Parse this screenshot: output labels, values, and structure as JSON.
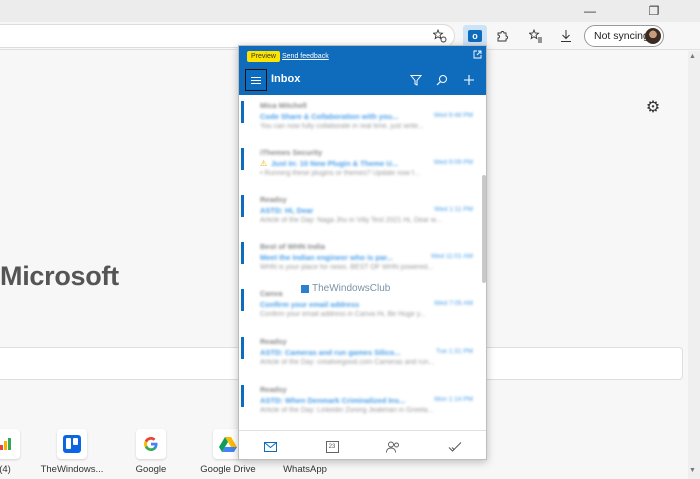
{
  "browser": {
    "sync_label": "Not syncing",
    "toolbar_icons": [
      "reading-view-icon",
      "outlook-extension-icon",
      "extensions-icon",
      "favorites-icon",
      "downloads-icon"
    ]
  },
  "page": {
    "title": "Microsoft",
    "tiles": [
      {
        "label": "(4)",
        "icon": "app-icon"
      },
      {
        "label": "TheWindows...",
        "icon": "trello-icon"
      },
      {
        "label": "Google",
        "icon": "google-icon"
      },
      {
        "label": "Google Drive",
        "icon": "google-drive-icon"
      },
      {
        "label": "WhatsApp",
        "icon": "whatsapp-icon"
      }
    ]
  },
  "outlook": {
    "preview_badge": "Preview",
    "feedback_link": "Send feedback",
    "folder": "Inbox",
    "messages": [
      {
        "sender": "Mica Mitchell",
        "subject": "Code Share & Collaboration with you...",
        "date": "Wed 9:48 PM",
        "preview": "You can now fully collaborate in real time, just write..."
      },
      {
        "sender": "iThemes Security",
        "subject": "Just In: 10 New Plugin & Theme U...",
        "date": "Wed 9:09 PM",
        "preview": "• Running these plugins or themes? Update now f..."
      },
      {
        "sender": "Readsy",
        "subject": "ASTD: Hi, Dear",
        "date": "Wed 1:11 PM",
        "preview": "Article of the Day: Naga Jhu in Villy Test 2021 Hi, Dear w..."
      },
      {
        "sender": "Best of WHN India",
        "subject": "Meet the Indian engineer who is par...",
        "date": "Wed 11:01 AM",
        "preview": "WHN is your place for news. BEST OF WHN powered..."
      },
      {
        "sender": "Canva",
        "subject": "Confirm your email address",
        "date": "Wed 7:05 AM",
        "preview": "Confirm your email address in Canva Hi, Be Huge y..."
      },
      {
        "sender": "Readsy",
        "subject": "ASTD: Cameras and run games Silico...",
        "date": "Tue 1:31 PM",
        "preview": "Article of the Day: creativegood.com Cameras and run..."
      },
      {
        "sender": "Readsy",
        "subject": "ASTD: When Denmark Criminalized Ins...",
        "date": "Mon 1:14 PM",
        "preview": "Article of the Day: Linkedin Zoning Jealerian in Greeta..."
      }
    ],
    "watermark": "TheWindowsClub",
    "footer_icons": [
      "mail-icon",
      "calendar-icon",
      "people-icon",
      "todo-icon"
    ],
    "calendar_day": "23"
  },
  "colors": {
    "outlook_blue": "#0f6cbd",
    "preview_yellow": "#fde300",
    "link_blue": "#4a9fea"
  }
}
